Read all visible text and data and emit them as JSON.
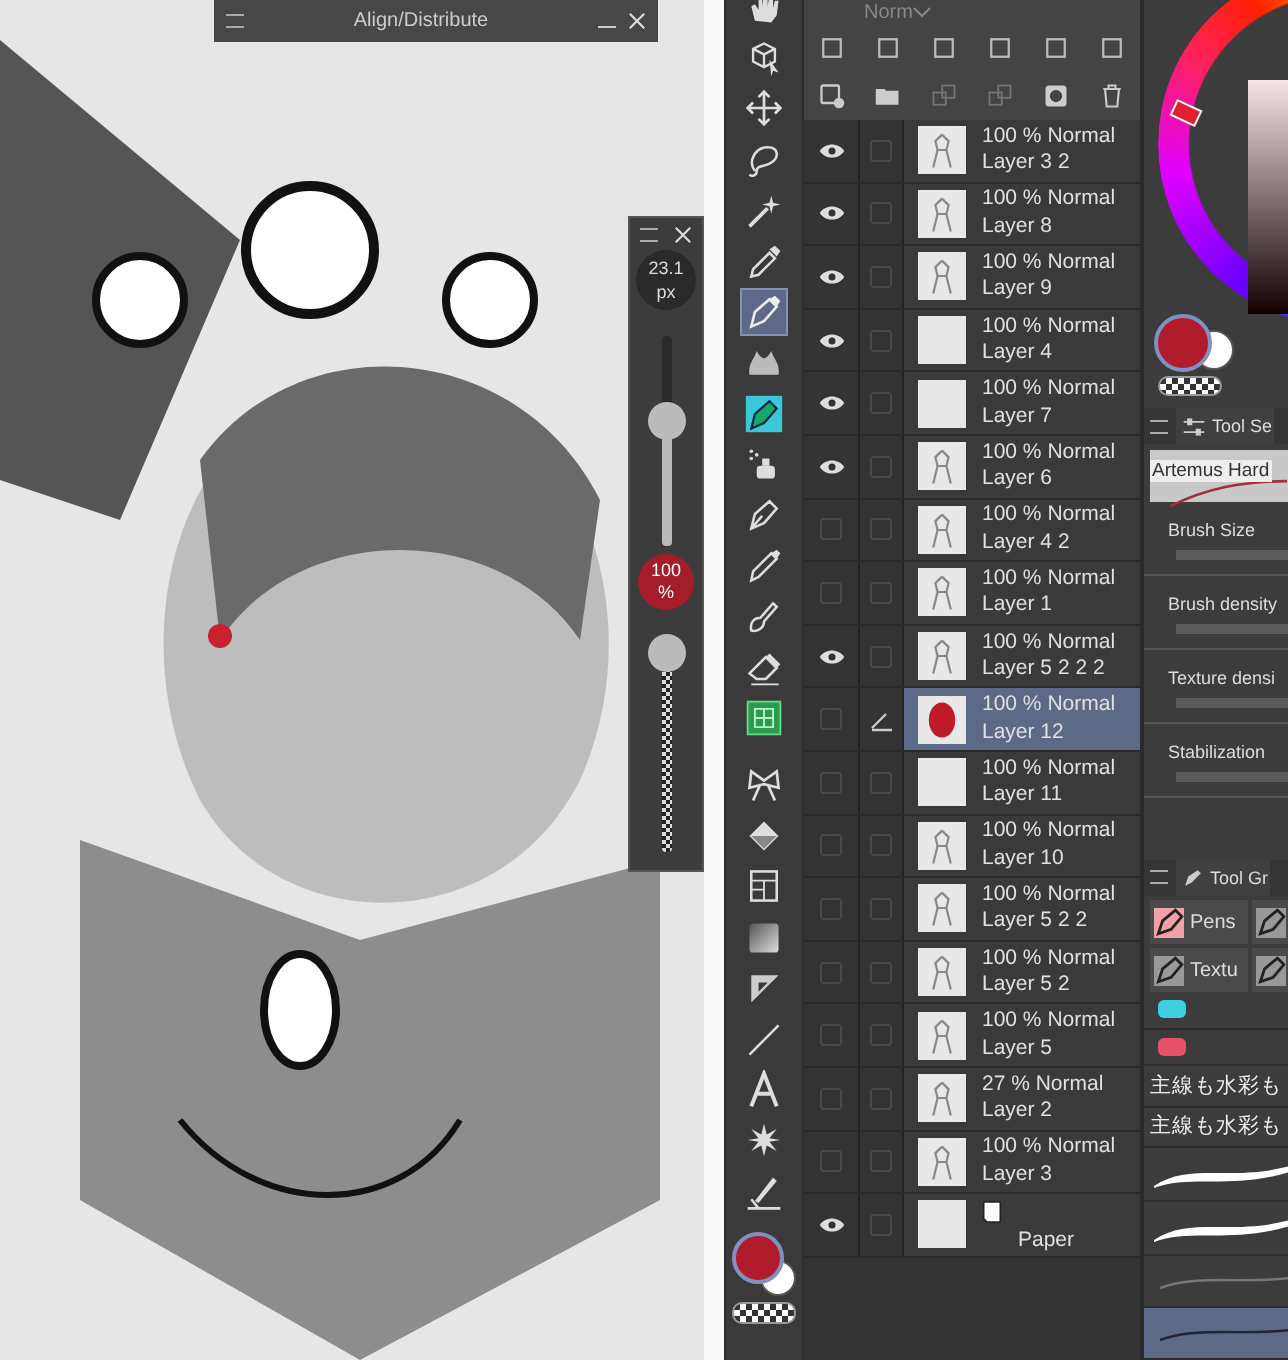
{
  "canvas": {
    "align_window": {
      "title": "Align/Distribute"
    },
    "brush_popup": {
      "size": "23.1",
      "size_unit": "px",
      "size_slider": {
        "level": 0.56
      },
      "opacity": "100",
      "opacity_unit": "%",
      "opacity_slider": {
        "level": 1.0
      }
    }
  },
  "tools": [
    {
      "kind": "hand",
      "selected": false,
      "divider_before": false
    },
    {
      "kind": "object",
      "selected": false,
      "divider_before": false
    },
    {
      "kind": "move",
      "selected": false,
      "divider_before": false
    },
    {
      "kind": "lasso",
      "selected": false,
      "divider_before": false
    },
    {
      "kind": "wand",
      "selected": false,
      "divider_before": false
    },
    {
      "kind": "eyedropper",
      "selected": false,
      "divider_before": false
    },
    {
      "kind": "pen",
      "selected": true,
      "divider_before": false
    },
    {
      "kind": "blend",
      "selected": false,
      "divider_before": false
    },
    {
      "kind": "marker",
      "selected": false,
      "divider_before": false
    },
    {
      "kind": "airbrush",
      "selected": false,
      "divider_before": false
    },
    {
      "kind": "nib",
      "selected": false,
      "divider_before": false
    },
    {
      "kind": "pencil",
      "selected": false,
      "divider_before": false
    },
    {
      "kind": "brush",
      "selected": false,
      "divider_before": false
    },
    {
      "kind": "eraser",
      "selected": false,
      "divider_before": false
    },
    {
      "kind": "fill",
      "selected": false,
      "divider_before": false
    },
    {
      "kind": "bow",
      "selected": false,
      "divider_before": true
    },
    {
      "kind": "bucket",
      "selected": false,
      "divider_before": false
    },
    {
      "kind": "frame",
      "selected": false,
      "divider_before": false
    },
    {
      "kind": "gradient",
      "selected": false,
      "divider_before": false
    },
    {
      "kind": "ruler",
      "selected": false,
      "divider_before": false
    },
    {
      "kind": "line",
      "selected": false,
      "divider_before": false
    },
    {
      "kind": "text",
      "selected": false,
      "divider_before": false
    },
    {
      "kind": "burst",
      "selected": false,
      "divider_before": false
    },
    {
      "kind": "correct",
      "selected": false,
      "divider_before": false
    }
  ],
  "layers": {
    "blend_mode": "Norm",
    "items": [
      {
        "kind": "layer",
        "visible": true,
        "editing": false,
        "selected": false,
        "mode": "100 % Normal",
        "name": "Layer 3 2",
        "thumbnail": {
          "kind": "sketch"
        }
      },
      {
        "kind": "layer",
        "visible": true,
        "editing": false,
        "selected": false,
        "mode": "100 % Normal",
        "name": "Layer 8",
        "thumbnail": {
          "kind": "sketch"
        }
      },
      {
        "kind": "layer",
        "visible": true,
        "editing": false,
        "selected": false,
        "mode": "100 % Normal",
        "name": "Layer 9",
        "thumbnail": {
          "kind": "sketch"
        }
      },
      {
        "kind": "layer",
        "visible": true,
        "editing": false,
        "selected": false,
        "mode": "100 % Normal",
        "name": "Layer 4",
        "thumbnail": {
          "kind": "blank"
        }
      },
      {
        "kind": "layer",
        "visible": true,
        "editing": false,
        "selected": false,
        "mode": "100 % Normal",
        "name": "Layer 7",
        "thumbnail": {
          "kind": "blank"
        }
      },
      {
        "kind": "layer",
        "visible": true,
        "editing": false,
        "selected": false,
        "mode": "100 % Normal",
        "name": "Layer 6",
        "thumbnail": {
          "kind": "sketch"
        }
      },
      {
        "kind": "layer",
        "visible": false,
        "editing": false,
        "selected": false,
        "mode": "100 % Normal",
        "name": "Layer 4 2",
        "thumbnail": {
          "kind": "sketch"
        }
      },
      {
        "kind": "layer",
        "visible": false,
        "editing": false,
        "selected": false,
        "mode": "100 % Normal",
        "name": "Layer 1",
        "thumbnail": {
          "kind": "sketch"
        }
      },
      {
        "kind": "layer",
        "visible": true,
        "editing": false,
        "selected": false,
        "mode": "100 % Normal",
        "name": "Layer 5 2 2 2",
        "thumbnail": {
          "kind": "sketch"
        }
      },
      {
        "kind": "layer",
        "visible": false,
        "editing": true,
        "selected": true,
        "mode": "100 % Normal",
        "name": "Layer 12",
        "thumbnail": {
          "kind": "red"
        }
      },
      {
        "kind": "layer",
        "visible": false,
        "editing": false,
        "selected": false,
        "mode": "100 % Normal",
        "name": "Layer 11",
        "thumbnail": {
          "kind": "blank"
        }
      },
      {
        "kind": "layer",
        "visible": false,
        "editing": false,
        "selected": false,
        "mode": "100 % Normal",
        "name": "Layer 10",
        "thumbnail": {
          "kind": "sketch"
        }
      },
      {
        "kind": "layer",
        "visible": false,
        "editing": false,
        "selected": false,
        "mode": "100 % Normal",
        "name": "Layer 5 2 2",
        "thumbnail": {
          "kind": "sketch"
        }
      },
      {
        "kind": "layer",
        "visible": false,
        "editing": false,
        "selected": false,
        "mode": "100 % Normal",
        "name": "Layer 5 2",
        "thumbnail": {
          "kind": "sketch"
        }
      },
      {
        "kind": "layer",
        "visible": false,
        "editing": false,
        "selected": false,
        "mode": "100 % Normal",
        "name": "Layer 5",
        "thumbnail": {
          "kind": "sketch"
        }
      },
      {
        "kind": "layer",
        "visible": false,
        "editing": false,
        "selected": false,
        "mode": "27 % Normal",
        "name": "Layer 2",
        "thumbnail": {
          "kind": "sketch"
        }
      },
      {
        "kind": "layer",
        "visible": false,
        "editing": false,
        "selected": false,
        "mode": "100 % Normal",
        "name": "Layer 3",
        "thumbnail": {
          "kind": "sketch"
        }
      },
      {
        "kind": "paper",
        "visible": true,
        "editing": false,
        "selected": false,
        "name": "Paper",
        "thumbnail": {
          "kind": "blank"
        }
      }
    ]
  },
  "tool_property": {
    "tab": "Tool Se",
    "brush_name": "Artemus Hard",
    "settings": [
      {
        "label": "Brush Size",
        "level": 1.0
      },
      {
        "label": "Brush density",
        "level": 1.0
      },
      {
        "label": "Texture densi",
        "level": 1.0
      },
      {
        "label": "Stabilization",
        "level": 1.0
      }
    ]
  },
  "sub_tool": {
    "tab": "Tool Gr",
    "groups": [
      {
        "label": "Pens",
        "selected": true
      },
      {
        "selected": false
      },
      {
        "label": "Textu",
        "selected": false
      },
      {
        "selected": false
      }
    ],
    "brushes": [
      {
        "kind": "swatch",
        "color": "#3fd0e0",
        "selected": false
      },
      {
        "kind": "swatch",
        "color": "#e8506a",
        "selected": false
      },
      {
        "kind": "named",
        "name": "主線も水彩も",
        "selected": false
      },
      {
        "kind": "named",
        "name": "主線も水彩も",
        "selected": false
      },
      {
        "kind": "stroke",
        "selected": false
      },
      {
        "kind": "stroke",
        "selected": false
      },
      {
        "kind": "thin",
        "selected": false
      },
      {
        "kind": "thin",
        "selected": true
      }
    ]
  }
}
